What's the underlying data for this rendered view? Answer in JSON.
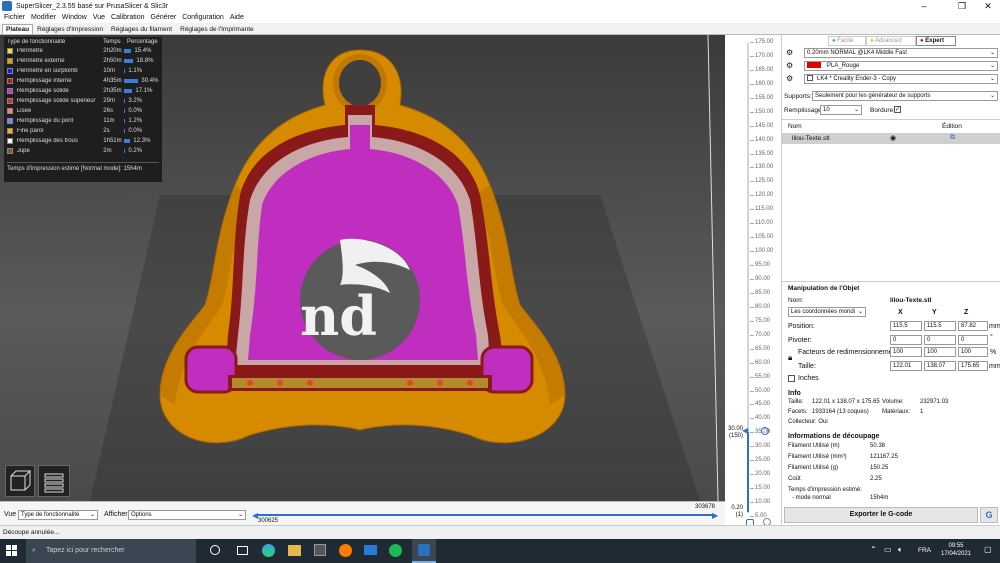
{
  "window": {
    "title": "SuperSlicer_2.3.55 basé sur PrusaSlicer & Slic3r"
  },
  "menu": [
    "Fichier",
    "Modifier",
    "Window",
    "Vue",
    "Calibration",
    "Générer",
    "Configuration",
    "Aide"
  ],
  "tabs": [
    "Plateau",
    "Réglages d'Impression",
    "Réglages du filament",
    "Réglages de l'Imprimante"
  ],
  "legend": {
    "headers": [
      "Type de fonctionnalité",
      "Temps",
      "Percentage"
    ],
    "rows": [
      {
        "name": "Périmètre",
        "time": "2h20m",
        "pct": "15.4%",
        "frac": 0.154,
        "color": "#f5e11a"
      },
      {
        "name": "Périmètre externe",
        "time": "2h50m",
        "pct": "18.8%",
        "frac": 0.188,
        "color": "#f29b00"
      },
      {
        "name": "Périmètre en surplomb",
        "time": "10m",
        "pct": "1.1%",
        "frac": 0.011,
        "color": "#1a1aff"
      },
      {
        "name": "Remplissage interne",
        "time": "4h35m",
        "pct": "30.4%",
        "frac": 0.304,
        "color": "#b2172b"
      },
      {
        "name": "Remplissage solide",
        "time": "2h35m",
        "pct": "17.1%",
        "frac": 0.171,
        "color": "#cc33cc"
      },
      {
        "name": "Remplissage solide supérieur",
        "time": "29m",
        "pct": "3.2%",
        "frac": 0.032,
        "color": "#ee2222"
      },
      {
        "name": "Lisée",
        "time": "26s",
        "pct": "0.0%",
        "frac": 0.0,
        "color": "#ff8080"
      },
      {
        "name": "Remplissage du pont",
        "time": "11m",
        "pct": "1.2%",
        "frac": 0.012,
        "color": "#8080ff"
      },
      {
        "name": "Fine paroi",
        "time": "2s",
        "pct": "0.0%",
        "frac": 0.0,
        "color": "#ffb000"
      },
      {
        "name": "Remplissage des trous",
        "time": "1h51m",
        "pct": "12.3%",
        "frac": 0.123,
        "color": "#ffffff"
      },
      {
        "name": "Jupe",
        "time": "2m",
        "pct": "0.2%",
        "frac": 0.002,
        "color": "#8b5a2b"
      }
    ],
    "footer": "Temps d'impression estimé [Normal mode]:  15h4m"
  },
  "viewport": {
    "overlay_text": "nd"
  },
  "vslider": {
    "ticks": [
      "175.00",
      "170.00",
      "165.00",
      "160.00",
      "155.00",
      "150.00",
      "145.00",
      "140.00",
      "135.00",
      "130.00",
      "125.00",
      "120.00",
      "115.00",
      "110.00",
      "105.00",
      "100.00",
      "95.00",
      "90.00",
      "85.00",
      "80.00",
      "75.00",
      "70.00",
      "65.00",
      "60.00",
      "55.00",
      "50.00",
      "45.00",
      "40.00",
      "35.00",
      "30.00",
      "25.00",
      "20.00",
      "15.00",
      "10.00",
      "5.00"
    ],
    "top_label": "30.00",
    "top_layer": "(150)",
    "bottom_label": "0.20",
    "bottom_layer": "(1)"
  },
  "viewbar": {
    "vue_label": "Vue",
    "vue_value": "Type de fonctionnalité",
    "afficher_label": "Afficher",
    "afficher_value": "Options",
    "hslider_left": "300625",
    "hslider_right": "303678"
  },
  "rpanel": {
    "modes": [
      "Facile",
      "Advanced",
      "Expert"
    ],
    "print_profile": "0.20mm NORMAL @LK4 Middle Fast",
    "filament_profile": "PLA_Rouge",
    "filament_color": "#e00000",
    "printer_profile": "LK4 * Creality Ender-3 - Copy",
    "supports_label": "Supports:",
    "supports_value": "Seulement pour les générateur de supports",
    "infill_label": "Remplissage:",
    "infill_value": "10",
    "brim_label": "Bordure:",
    "obj_col_name": "Nom",
    "obj_col_edit": "Édition",
    "object_name": "lilou-Texte.stl",
    "manip_title": "Manipulation de l'Objet",
    "manip_name_label": "Nom:",
    "manip_name_value": "lilou-Texte.stl",
    "coords_value": "Les coordonnées mondi",
    "axes": [
      "X",
      "Y",
      "Z"
    ],
    "position_label": "Position:",
    "position": [
      "115.5",
      "115.5",
      "87.82"
    ],
    "position_unit": "mm",
    "rotate_label": "Pivoter:",
    "rotate": [
      "0",
      "0",
      "0"
    ],
    "rotate_unit": "°",
    "scale_label": "Facteurs de redimensionnement:",
    "scale": [
      "100",
      "100",
      "100"
    ],
    "scale_unit": "%",
    "size_label": "Taille:",
    "size": [
      "122.01",
      "138.07",
      "175.65"
    ],
    "size_unit": "mm",
    "inches_label": "Inches",
    "info_title": "Info",
    "info_size_label": "Taille:",
    "info_size": "122.01 x 138.07 x 175.65",
    "info_volume_label": "Volume:",
    "info_volume": "232971.03",
    "info_facets_label": "Facets:",
    "info_facets": "1933164 (13 coques)",
    "info_materials_label": "Matériaux:",
    "info_materials": "1",
    "info_collector": "Collecteur: Oui",
    "slice_title": "Informations de découpage",
    "slice_rows": [
      {
        "label": "Filament Utilisé (m)",
        "value": "50.38"
      },
      {
        "label": "Filament Utilisé (mm³)",
        "value": "121167.25"
      },
      {
        "label": "Filament Utilisé (g)",
        "value": "150.25"
      },
      {
        "label": "Coût",
        "value": "2.25"
      }
    ],
    "time_label": "Temps d'impression estimé:",
    "time_mode": "- mode normal",
    "time_value": "15h4m",
    "export_label": "Exporter le G-code"
  },
  "statusbar": {
    "text": "Découpe annulée..."
  },
  "taskbar": {
    "search_placeholder": "Tapez ici pour rechercher",
    "lang": "FRA",
    "time": "09:55",
    "date": "17/04/2021"
  }
}
